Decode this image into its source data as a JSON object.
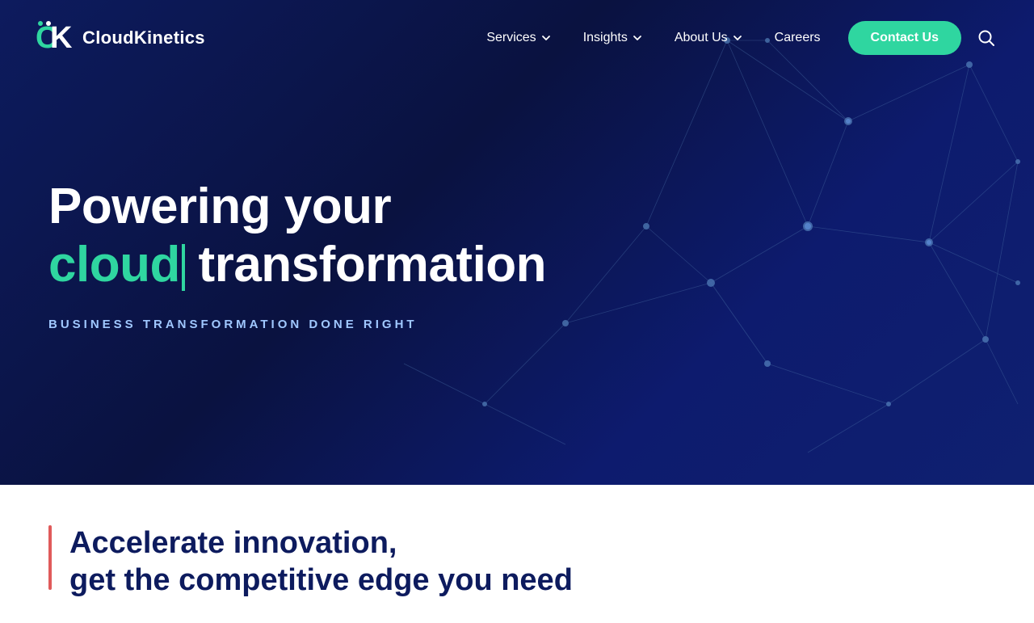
{
  "brand": {
    "logo_text": "CloudKinetics",
    "logo_alt": "CloudKinetics logo"
  },
  "navbar": {
    "items": [
      {
        "label": "Services",
        "has_dropdown": true
      },
      {
        "label": "Insights",
        "has_dropdown": true
      },
      {
        "label": "About Us",
        "has_dropdown": true
      },
      {
        "label": "Careers",
        "has_dropdown": false
      }
    ],
    "contact_label": "Contact Us"
  },
  "hero": {
    "title_line1": "Powering your",
    "title_cloud": "cloud",
    "title_transform": " transformation",
    "subtitle": "BUSINESS TRANSFORMATION DONE RIGHT"
  },
  "below_hero": {
    "accelerate_line1": "Accelerate innovation,",
    "accelerate_line2": "get the competitive edge you need"
  },
  "colors": {
    "accent_green": "#2fd6a0",
    "accent_red": "#e05a5a",
    "navy": "#0d1b5e",
    "white": "#ffffff"
  }
}
